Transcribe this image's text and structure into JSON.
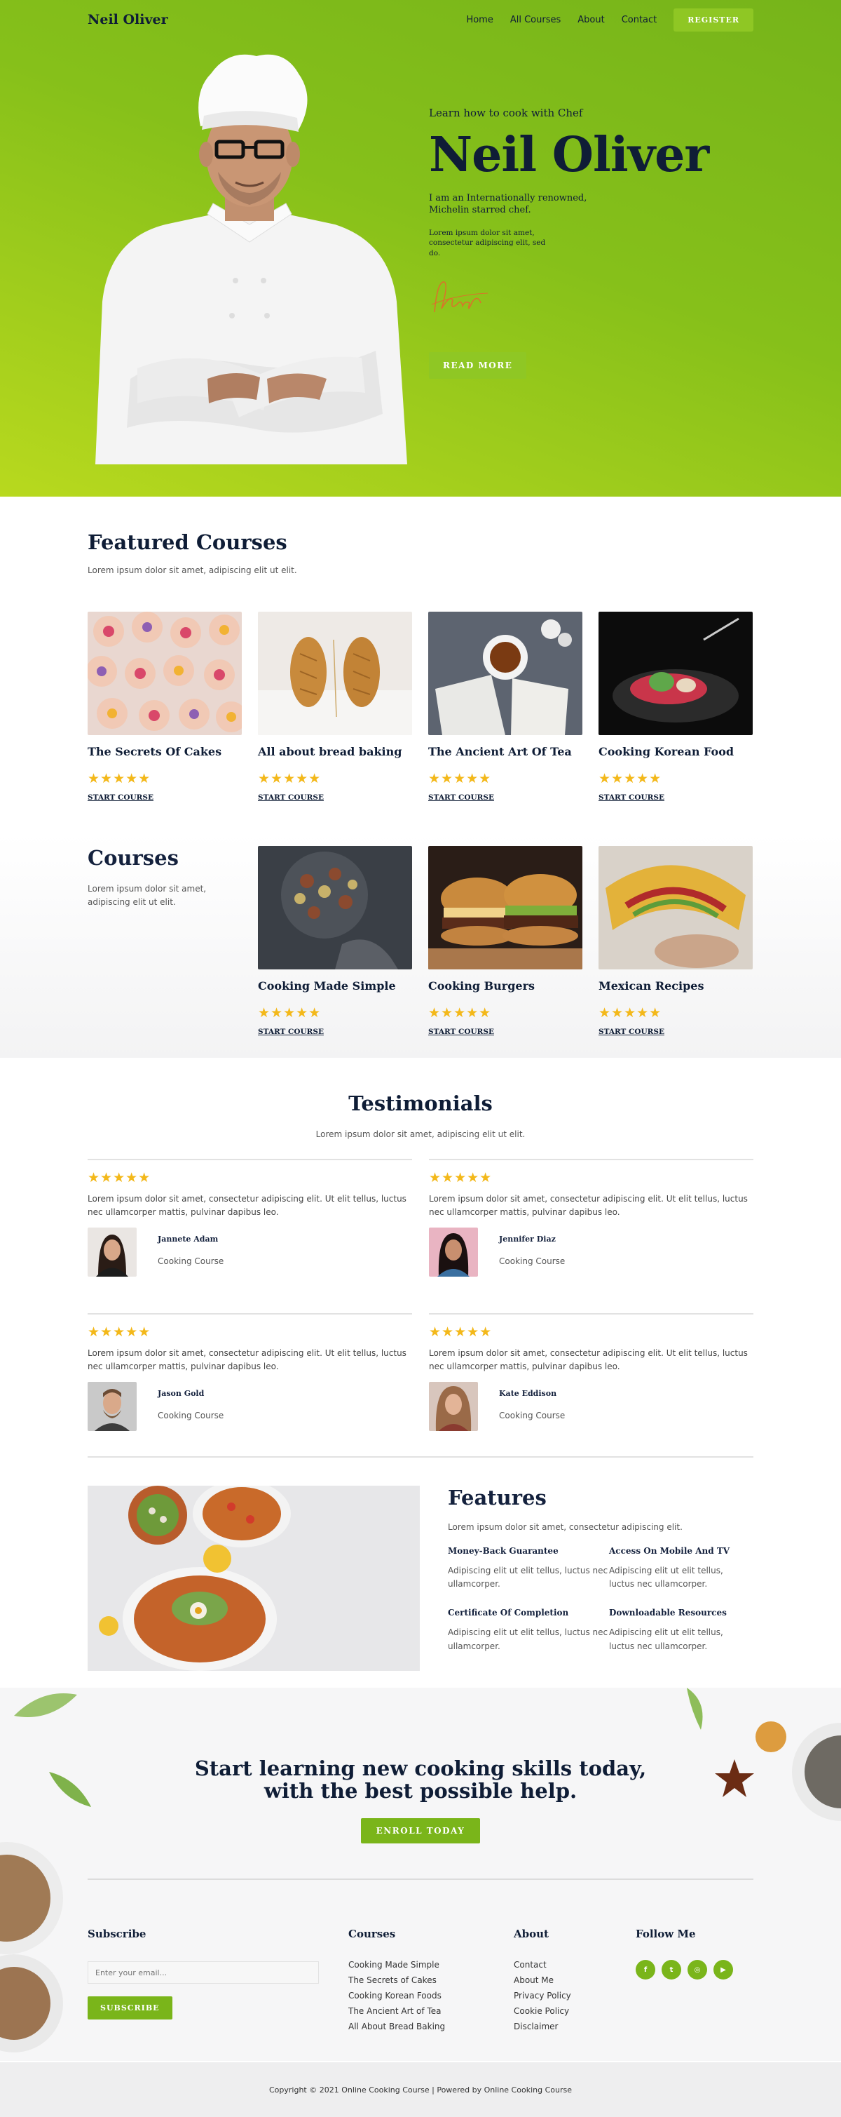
{
  "nav": {
    "logo": "Neil Oliver",
    "links": [
      "Home",
      "All Courses",
      "About",
      "Contact"
    ],
    "register": "REGISTER"
  },
  "hero": {
    "subtitle": "Learn how to cook with Chef",
    "title": "Neil Oliver",
    "desc": "I am an Internationally renowned, Michelin starred chef.",
    "small": "Lorem ipsum dolor sit amet, consectetur adipiscing elit, sed do.",
    "button": "READ MORE"
  },
  "featured": {
    "title": "Featured Courses",
    "subtitle": "Lorem ipsum dolor sit amet, adipiscing elit ut elit.",
    "cards": [
      {
        "title": "The Secrets Of Cakes",
        "stars": "★★★★★",
        "link": "START COURSE"
      },
      {
        "title": "All about bread baking",
        "stars": "★★★★★",
        "link": "START COURSE"
      },
      {
        "title": "The Ancient Art Of Tea",
        "stars": "★★★★★",
        "link": "START COURSE"
      },
      {
        "title": "Cooking Korean Food",
        "stars": "★★★★★",
        "link": "START COURSE"
      }
    ]
  },
  "courses": {
    "title": "Courses",
    "subtitle": "Lorem ipsum dolor sit amet, adipiscing elit ut elit.",
    "cards": [
      {
        "title": "Cooking Made Simple",
        "stars": "★★★★★",
        "link": "START COURSE"
      },
      {
        "title": "Cooking Burgers",
        "stars": "★★★★★",
        "link": "START COURSE"
      },
      {
        "title": "Mexican Recipes",
        "stars": "★★★★★",
        "link": "START COURSE"
      }
    ]
  },
  "testimonials": {
    "title": "Testimonials",
    "subtitle": "Lorem ipsum dolor sit amet, adipiscing elit ut elit.",
    "items": [
      {
        "stars": "★★★★★",
        "text": "Lorem ipsum dolor sit amet, consectetur adipiscing elit. Ut elit tellus, luctus nec ullamcorper mattis, pulvinar dapibus leo.",
        "name": "Jannete Adam",
        "role": "Cooking Course"
      },
      {
        "stars": "★★★★★",
        "text": "Lorem ipsum dolor sit amet, consectetur adipiscing elit. Ut elit tellus, luctus nec ullamcorper mattis, pulvinar dapibus leo.",
        "name": "Jennifer Diaz",
        "role": "Cooking Course"
      },
      {
        "stars": "★★★★★",
        "text": "Lorem ipsum dolor sit amet, consectetur adipiscing elit. Ut elit tellus, luctus nec ullamcorper mattis, pulvinar dapibus leo.",
        "name": "Jason Gold",
        "role": "Cooking Course"
      },
      {
        "stars": "★★★★★",
        "text": "Lorem ipsum dolor sit amet, consectetur adipiscing elit. Ut elit tellus, luctus nec ullamcorper mattis, pulvinar dapibus leo.",
        "name": "Kate Eddison",
        "role": "Cooking Course"
      }
    ]
  },
  "features": {
    "title": "Features",
    "subtitle": "Lorem ipsum dolor sit amet, consectetur adipiscing elit.",
    "items": [
      {
        "title": "Money-Back Guarantee",
        "text": "Adipiscing elit ut elit tellus, luctus nec ullamcorper."
      },
      {
        "title": "Access On Mobile And TV",
        "text": "Adipiscing elit ut elit tellus, luctus nec ullamcorper."
      },
      {
        "title": "Certificate Of Completion",
        "text": "Adipiscing elit ut elit tellus, luctus nec ullamcorper."
      },
      {
        "title": "Downloadable Resources",
        "text": "Adipiscing elit ut elit tellus, luctus nec ullamcorper."
      }
    ]
  },
  "cta": {
    "line1": "Start learning new cooking skills today,",
    "line2": "with the best possible help.",
    "button": "ENROLL TODAY"
  },
  "footer": {
    "subscribe_title": "Subscribe",
    "email_placeholder": "Enter your email...",
    "subscribe_button": "SUBSCRIBE",
    "courses_title": "Courses",
    "courses_links": [
      "Cooking Made Simple",
      "The Secrets of Cakes",
      "Cooking Korean Foods",
      "The Ancient Art of Tea",
      "All About Bread Baking"
    ],
    "about_title": "About",
    "about_links": [
      "Contact",
      "About Me",
      "Privacy Policy",
      "Cookie Policy",
      "Disclaimer"
    ],
    "follow_title": "Follow Me",
    "socials": [
      "facebook-icon",
      "twitter-icon",
      "instagram-icon",
      "youtube-icon"
    ],
    "copyright": "Copyright © 2021 Online Cooking Course | Powered by Online Cooking Course"
  },
  "colors": {
    "accent": "#7ab51a",
    "hero_green": "#86c01a",
    "navy": "#0f1d36",
    "star": "#f3b81a"
  }
}
